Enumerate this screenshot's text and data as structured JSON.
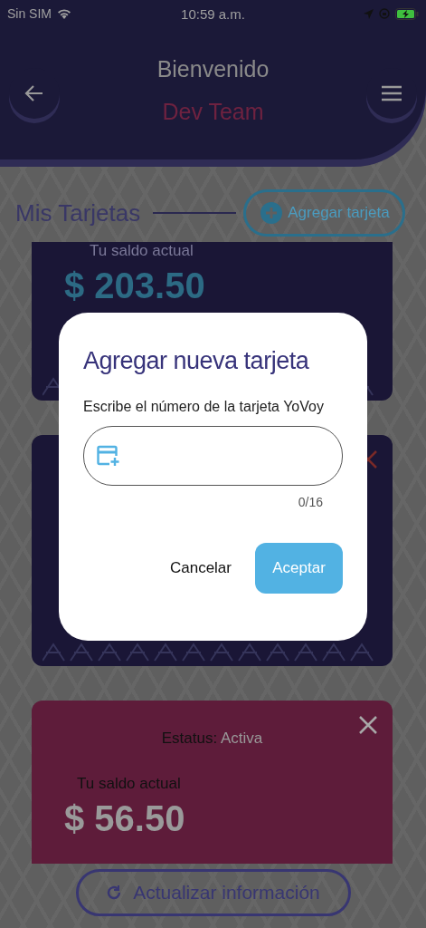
{
  "status_bar": {
    "carrier": "Sin SIM",
    "time": "10:59 a.m."
  },
  "header": {
    "title": "Bienvenido",
    "subtitle": "Dev Team"
  },
  "section": {
    "title": "Mis Tarjetas",
    "add_button": "Agregar tarjeta"
  },
  "cards": [
    {
      "kind": "navy",
      "closable": false,
      "balance_label": "Tu saldo actual",
      "balance": "$ 203.50"
    },
    {
      "kind": "navy",
      "closable": true
    },
    {
      "kind": "crimson",
      "closable": true,
      "status_label": "Estatus:",
      "status": "Activa",
      "balance_label": "Tu saldo actual",
      "balance": "$ 56.50"
    }
  ],
  "refresh_button": "Actualizar información",
  "dialog": {
    "title": "Agregar nueva tarjeta",
    "label": "Escribe el número de la tarjeta YoVoy",
    "counter": "0/16",
    "cancel": "Cancelar",
    "accept": "Aceptar"
  }
}
